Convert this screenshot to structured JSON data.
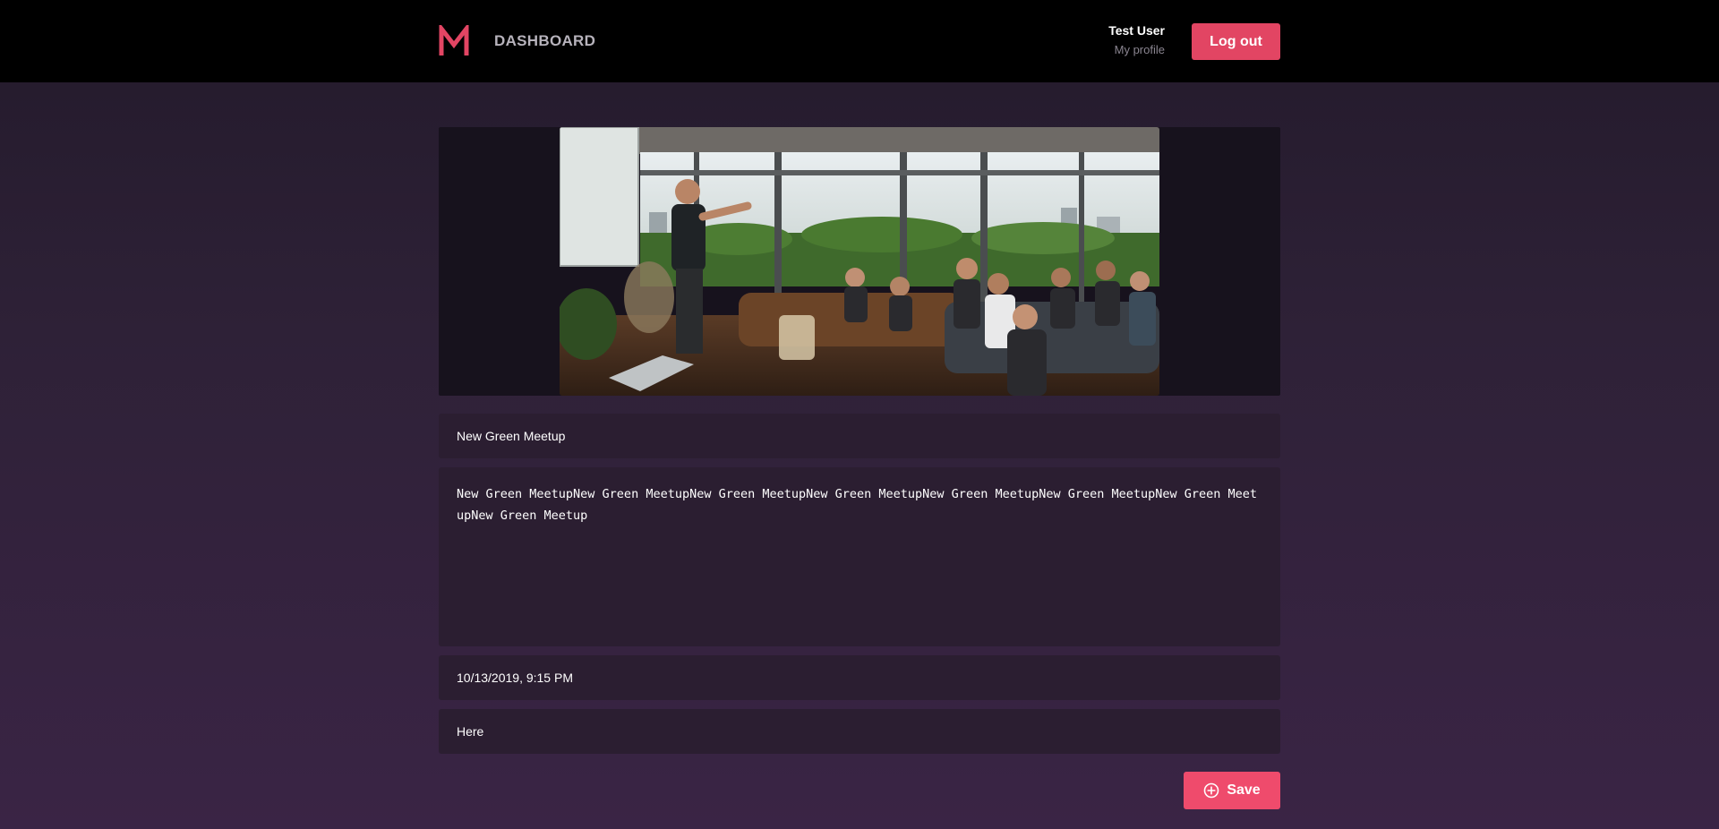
{
  "header": {
    "logo_letter": "M",
    "title": "DASHBOARD",
    "user_name": "Test User",
    "profile_link": "My profile",
    "logout_label": "Log out"
  },
  "form": {
    "image_icon": "meetup-photo",
    "title_value": "New Green Meetup",
    "description_value": "New Green MeetupNew Green MeetupNew Green MeetupNew Green MeetupNew Green MeetupNew Green MeetupNew Green MeetupNew Green Meetup",
    "date_value": "10/13/2019, 9:15 PM",
    "location_value": "Here",
    "save_label": "Save"
  },
  "colors": {
    "accent": "#e24563",
    "save": "#ef4b6c",
    "header_bg": "#000000",
    "field_bg": "#2b1e31"
  }
}
